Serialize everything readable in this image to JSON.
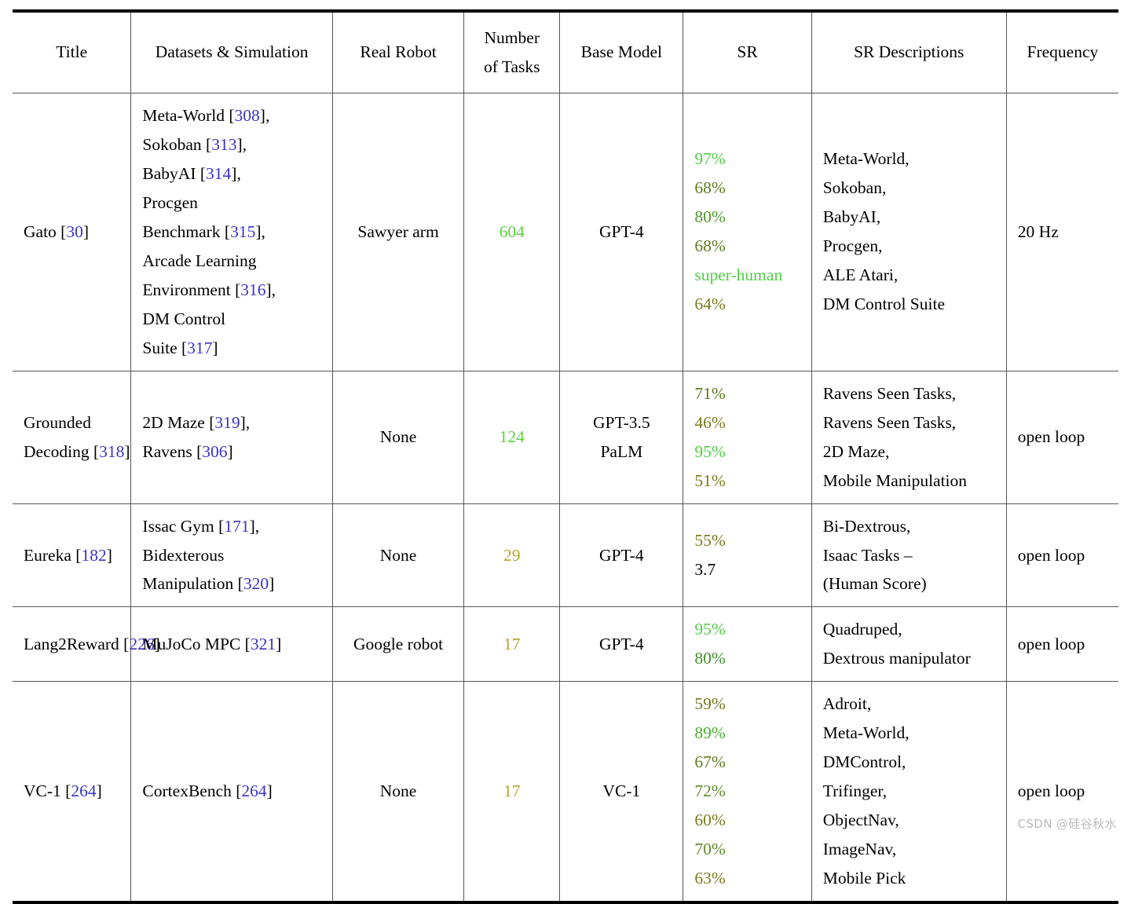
{
  "table": {
    "columns": [
      {
        "key": "title",
        "label": "Title"
      },
      {
        "key": "datasets",
        "label": "Datasets & Simulation"
      },
      {
        "key": "real_robot",
        "label": "Real Robot"
      },
      {
        "key": "num_tasks",
        "label": "Number\nof Tasks"
      },
      {
        "key": "base_model",
        "label": "Base Model"
      },
      {
        "key": "sr",
        "label": "SR"
      },
      {
        "key": "sr_desc",
        "label": "SR Descriptions"
      },
      {
        "key": "frequency",
        "label": "Frequency"
      }
    ],
    "header_num_tasks_line1": "Number",
    "header_num_tasks_line2": "of Tasks",
    "rows": [
      {
        "title": {
          "name": "Gato",
          "cite": "[30]"
        },
        "datasets": [
          {
            "name": "Meta-World",
            "cite": "[308]",
            "tail": ","
          },
          {
            "name": "Sokoban",
            "cite": "[313]",
            "tail": ","
          },
          {
            "name": "BabyAI",
            "cite": "[314]",
            "tail": ","
          },
          {
            "name": "Procgen",
            "cite": "",
            "tail": ""
          },
          {
            "name": "Benchmark",
            "cite": "[315]",
            "tail": ","
          },
          {
            "name": "Arcade Learning",
            "cite": "",
            "tail": ""
          },
          {
            "name": "Environment",
            "cite": "[316]",
            "tail": ","
          },
          {
            "name": "DM Control",
            "cite": "",
            "tail": ""
          },
          {
            "name": "Suite",
            "cite": "[317]",
            "tail": ""
          }
        ],
        "real_robot": "Sawyer arm",
        "num_tasks": {
          "value": "604",
          "color": "#5ad23c"
        },
        "base_model": [
          "GPT-4"
        ],
        "sr": [
          {
            "value": "97%",
            "color": "#4fce45"
          },
          {
            "value": "68%",
            "color": "#5c7d1f"
          },
          {
            "value": "80%",
            "color": "#4c9b2c"
          },
          {
            "value": "68%",
            "color": "#5c7d1f"
          },
          {
            "value": "super-human",
            "color": "#4fce45"
          },
          {
            "value": "64%",
            "color": "#7b7a1c"
          }
        ],
        "sr_desc": [
          "Meta-World,",
          "Sokoban,",
          "BabyAI,",
          "Procgen,",
          "ALE Atari,",
          "DM Control Suite"
        ],
        "frequency": "20 Hz"
      },
      {
        "title": {
          "name": "Grounded\nDecoding",
          "cite": "[318]"
        },
        "title_line1": "Grounded",
        "title_line2": "Decoding",
        "datasets": [
          {
            "name": "2D Maze",
            "cite": "[319]",
            "tail": ","
          },
          {
            "name": "Ravens",
            "cite": "[306]",
            "tail": ""
          }
        ],
        "real_robot": "None",
        "num_tasks": {
          "value": "124",
          "color": "#5ad23c"
        },
        "base_model": [
          "GPT-3.5",
          "PaLM"
        ],
        "sr": [
          {
            "value": "71%",
            "color": "#567a1d"
          },
          {
            "value": "46%",
            "color": "#7b7a1c"
          },
          {
            "value": "95%",
            "color": "#4fce45"
          },
          {
            "value": "51%",
            "color": "#7b7a1c"
          }
        ],
        "sr_desc": [
          "Ravens Seen Tasks,",
          "Ravens Seen Tasks,",
          "2D Maze,",
          "Mobile Manipulation"
        ],
        "frequency": "open loop"
      },
      {
        "title": {
          "name": "Eureka",
          "cite": "[182]"
        },
        "datasets": [
          {
            "name": "Issac Gym",
            "cite": "[171]",
            "tail": ","
          },
          {
            "name": "Bidexterous",
            "cite": "",
            "tail": ""
          },
          {
            "name": "Manipulation",
            "cite": "[320]",
            "tail": ""
          }
        ],
        "real_robot": "None",
        "num_tasks": {
          "value": "29",
          "color": "#b5a52a"
        },
        "base_model": [
          "GPT-4"
        ],
        "sr": [
          {
            "value": "55%",
            "color": "#7b7a1c"
          },
          {
            "value": "3.7",
            "color": "#000000"
          }
        ],
        "sr_desc": [
          "Bi-Dextrous,",
          "Isaac Tasks –",
          "(Human Score)"
        ],
        "frequency": "open loop"
      },
      {
        "title": {
          "name": "Lang2Reward",
          "cite": "[226]"
        },
        "datasets": [
          {
            "name": "MuJoCo MPC",
            "cite": "[321]",
            "tail": ""
          }
        ],
        "real_robot": "Google robot",
        "num_tasks": {
          "value": "17",
          "color": "#b5a52a"
        },
        "base_model": [
          "GPT-4"
        ],
        "sr": [
          {
            "value": "95%",
            "color": "#4fce45"
          },
          {
            "value": "80%",
            "color": "#3f8f2a"
          }
        ],
        "sr_desc": [
          "Quadruped,",
          "Dextrous manipulator"
        ],
        "frequency": "open loop"
      },
      {
        "title": {
          "name": "VC-1",
          "cite": "[264]"
        },
        "datasets": [
          {
            "name": "CortexBench",
            "cite": "[264]",
            "tail": ""
          }
        ],
        "real_robot": "None",
        "num_tasks": {
          "value": "17",
          "color": "#b5a52a"
        },
        "base_model": [
          "VC-1"
        ],
        "sr": [
          {
            "value": "59%",
            "color": "#74791e"
          },
          {
            "value": "89%",
            "color": "#4aae33"
          },
          {
            "value": "67%",
            "color": "#5c7d1f"
          },
          {
            "value": "72%",
            "color": "#61892a"
          },
          {
            "value": "60%",
            "color": "#7b7a1c"
          },
          {
            "value": "70%",
            "color": "#61892a"
          },
          {
            "value": "63%",
            "color": "#7b7a1c"
          }
        ],
        "sr_desc": [
          "Adroit,",
          "Meta-World,",
          "DMControl,",
          "Trifinger,",
          "ObjectNav,",
          "ImageNav,",
          "Mobile Pick"
        ],
        "frequency": "open loop"
      }
    ]
  },
  "watermark": "CSDN @硅谷秋水",
  "colors": {
    "citation": "#3a32c8",
    "rule": "#000000"
  }
}
